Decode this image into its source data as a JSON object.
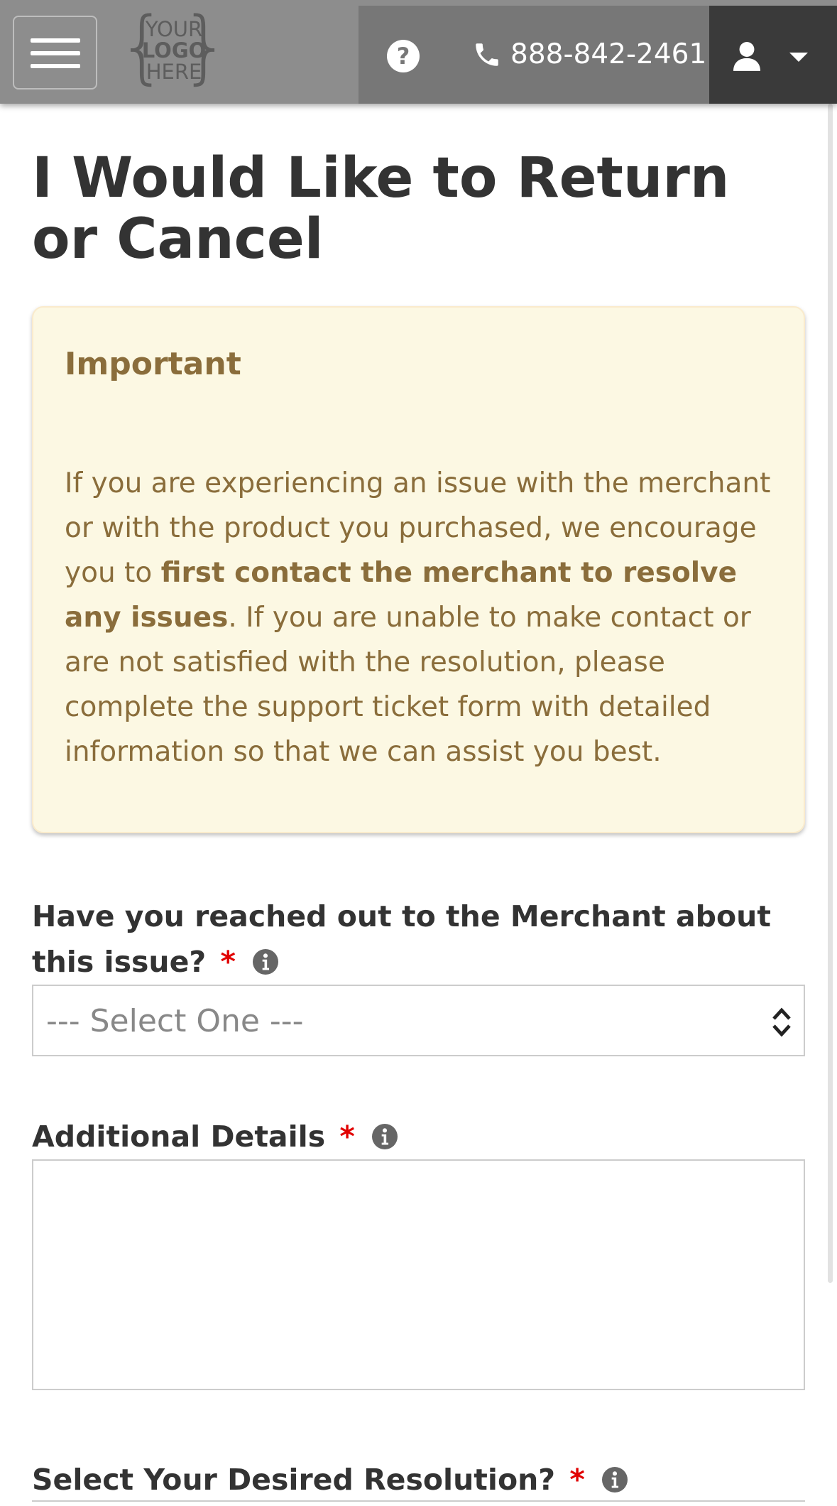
{
  "header": {
    "logo": {
      "line1": "YOUR",
      "line2": "LOGO",
      "line3": "HERE"
    },
    "phone": "888-842-2461",
    "icons": {
      "menu": "hamburger-menu-icon",
      "help": "question-circle-icon",
      "phone": "phone-icon",
      "user": "user-icon",
      "caret": "caret-down-icon"
    }
  },
  "page": {
    "title": "I Would Like to Return or Cancel"
  },
  "alert": {
    "title": "Important",
    "text_before": "If you are experiencing an issue with the merchant or with the product you purchased, we encourage you to ",
    "text_bold": "first contact the merchant to resolve any issues",
    "text_after": ". If you are unable to make contact or are not satisfied with the resolution, please complete the support ticket form with detailed information so that we can assist you best."
  },
  "form": {
    "required_mark": "*",
    "q1": {
      "label": "Have you reached out to the Merchant about this issue?",
      "selected": "--- Select One ---"
    },
    "q2": {
      "label": "Additional Details",
      "value": ""
    },
    "q3": {
      "label": "Select Your Desired Resolution?"
    }
  },
  "colors": {
    "header_bg": "#8d8d8d",
    "nav_bg": "#777777",
    "user_bg": "#3a3a3a",
    "alert_bg": "#fcf8e3",
    "alert_text": "#8a6d3b",
    "required": "#e10000"
  }
}
